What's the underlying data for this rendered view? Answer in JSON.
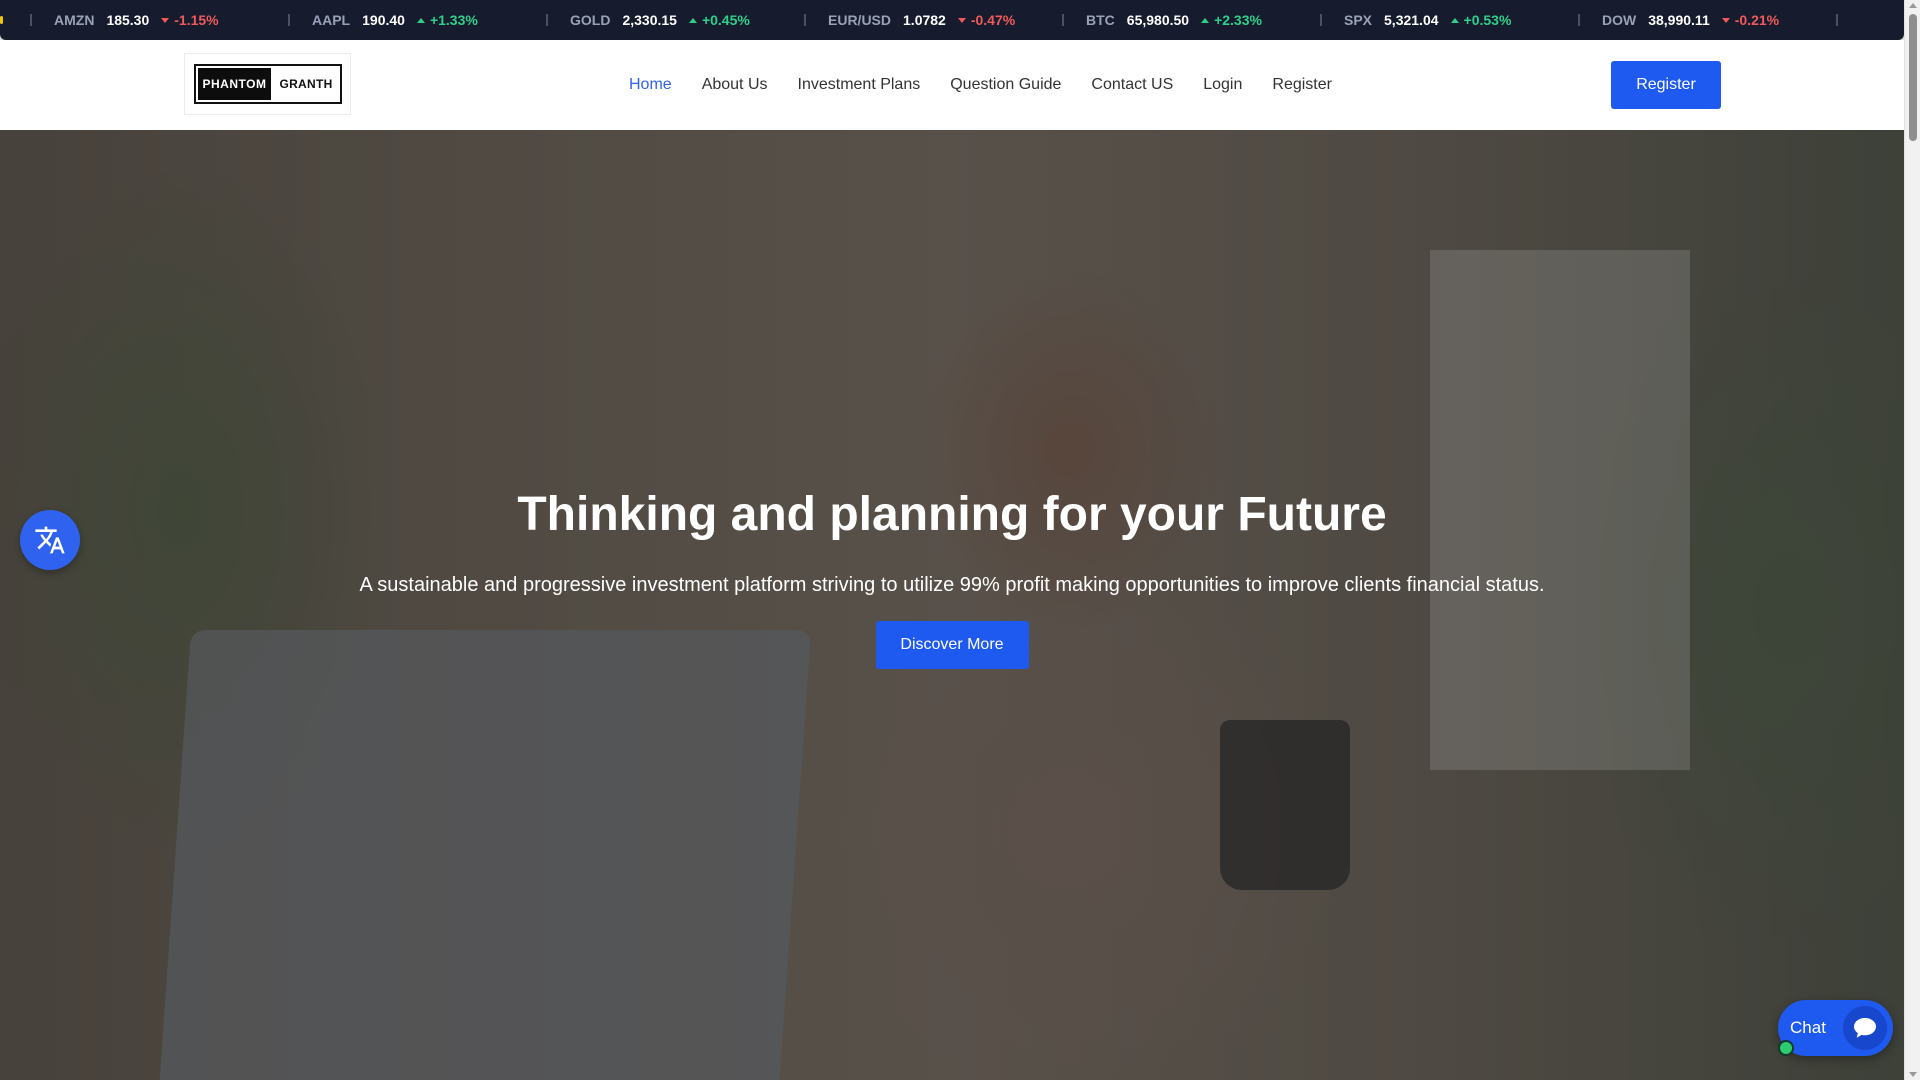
{
  "ticker": {
    "items": [
      {
        "symbol": "AMZN",
        "price": "185.30",
        "change": "-1.15%",
        "direction": "down"
      },
      {
        "symbol": "AAPL",
        "price": "190.40",
        "change": "+1.33%",
        "direction": "up"
      },
      {
        "symbol": "GOLD",
        "price": "2,330.15",
        "change": "+0.45%",
        "direction": "up"
      },
      {
        "symbol": "EUR/USD",
        "price": "1.0782",
        "change": "-0.47%",
        "direction": "down"
      },
      {
        "symbol": "BTC",
        "price": "65,980.50",
        "change": "+2.33%",
        "direction": "up"
      },
      {
        "symbol": "SPX",
        "price": "5,321.04",
        "change": "+0.53%",
        "direction": "up"
      },
      {
        "symbol": "DOW",
        "price": "38,990.11",
        "change": "-0.21%",
        "direction": "down"
      }
    ],
    "colors": {
      "background": "#161b2e",
      "up": "#2fd08a",
      "down": "#f05a5a"
    }
  },
  "header": {
    "logo": {
      "left_text": "PHANTOM",
      "right_text": "GRANTH"
    },
    "nav": [
      {
        "label": "Home",
        "active": true
      },
      {
        "label": "About Us",
        "active": false
      },
      {
        "label": "Investment Plans",
        "active": false
      },
      {
        "label": "Question Guide",
        "active": false
      },
      {
        "label": "Contact US",
        "active": false
      },
      {
        "label": "Login",
        "active": false
      },
      {
        "label": "Register",
        "active": false
      }
    ],
    "register_label": "Register",
    "accent_color": "#1e5af0"
  },
  "hero": {
    "title": "Thinking and planning for your Future",
    "subtitle": "A sustainable and progressive investment platform striving to utilize 99% profit making opportunities to improve clients financial status.",
    "cta_label": "Discover More"
  },
  "widgets": {
    "translate_icon": "translate-icon",
    "chat_label": "Chat",
    "chat_icon": "chat-bubble-icon",
    "chat_status": "online"
  }
}
